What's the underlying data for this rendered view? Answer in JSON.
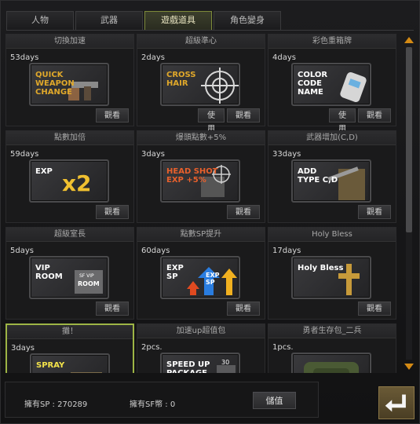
{
  "tabs": [
    {
      "label": "人物",
      "active": false
    },
    {
      "label": "武器",
      "active": false
    },
    {
      "label": "遊戲道具",
      "active": true
    },
    {
      "label": "角色變身",
      "active": false
    }
  ],
  "items": [
    {
      "title": "切換加速",
      "duration": "53days",
      "banner_text": "QUICK\nWEAPON\nCHANGE",
      "banner_color": "#e0a82a",
      "icon": "pistol-icon",
      "use_label": "",
      "view_label": "觀看",
      "selected": false
    },
    {
      "title": "超級準心",
      "duration": "2days",
      "banner_text": "CROSS\nHAIR",
      "banner_color": "#e0a82a",
      "icon": "crosshair-icon",
      "use_label": "使用",
      "view_label": "觀看",
      "selected": false
    },
    {
      "title": "彩色重箱牌",
      "duration": "4days",
      "banner_text": "COLOR\nCODE\nNAME",
      "banner_color": "#ffffff",
      "icon": "dog-tag-icon",
      "use_label": "使用",
      "view_label": "觀看",
      "selected": false
    },
    {
      "title": "點數加倍",
      "duration": "59days",
      "banner_text": "EXP",
      "banner_color": "#ffffff",
      "icon": "x2-icon",
      "use_label": "",
      "view_label": "觀看",
      "selected": false
    },
    {
      "title": "爆頭點數+5%",
      "duration": "3days",
      "banner_text": "HEAD SHOT\nEXP +5%",
      "banner_color": "#e8602c",
      "icon": "headshot-target-icon",
      "use_label": "",
      "view_label": "觀看",
      "selected": false
    },
    {
      "title": "武器增加(C,D)",
      "duration": "33days",
      "banner_text": "ADD\nTYPE C,D",
      "banner_color": "#ffffff",
      "icon": "soldier-icon",
      "use_label": "",
      "view_label": "觀看",
      "selected": false
    },
    {
      "title": "超級室長",
      "duration": "5days",
      "banner_text": "VIP\nROOM",
      "banner_color": "#ffffff",
      "icon": "vip-room-icon",
      "use_label": "",
      "view_label": "觀看",
      "selected": false
    },
    {
      "title": "點數SP提升",
      "duration": "60days",
      "banner_text": "EXP\nSP",
      "banner_color": "#ffffff",
      "icon": "up-arrows-icon",
      "use_label": "",
      "view_label": "觀看",
      "selected": false
    },
    {
      "title": "Holy Bless",
      "duration": "17days",
      "banner_text": "Holy Bless",
      "banner_color": "#ffffff",
      "icon": "cross-icon",
      "use_label": "",
      "view_label": "觀看",
      "selected": false
    },
    {
      "title": "攤！",
      "duration": "3days",
      "banner_text": "SPRAY",
      "banner_color": "#f2e24a",
      "icon": "spray-icon",
      "use_label": "",
      "view_label": "",
      "selected": true
    },
    {
      "title": "加速up超值包",
      "duration": "2pcs.",
      "banner_text": "SPEED UP\nPACKAGE",
      "banner_color": "#ffffff",
      "icon": "package-icon",
      "use_label": "",
      "view_label": "",
      "selected": false
    },
    {
      "title": "勇者生存包_二兵",
      "duration": "1pcs.",
      "banner_text": "",
      "banner_color": "#ffffff",
      "icon": "survival-pack-icon",
      "use_label": "",
      "view_label": "",
      "selected": false
    }
  ],
  "banner_extras": {
    "x2_text": "x2",
    "sf_vip_text": "SF VIP",
    "room_text": "ROOM",
    "exp_sp_arrow_text": "EXP\nSP",
    "package_30_text": "30"
  },
  "footer": {
    "sp_label": "擁有SP : 270289",
    "sf_label": "擁有SF幣 : 0",
    "deposit_label": "儲值"
  }
}
